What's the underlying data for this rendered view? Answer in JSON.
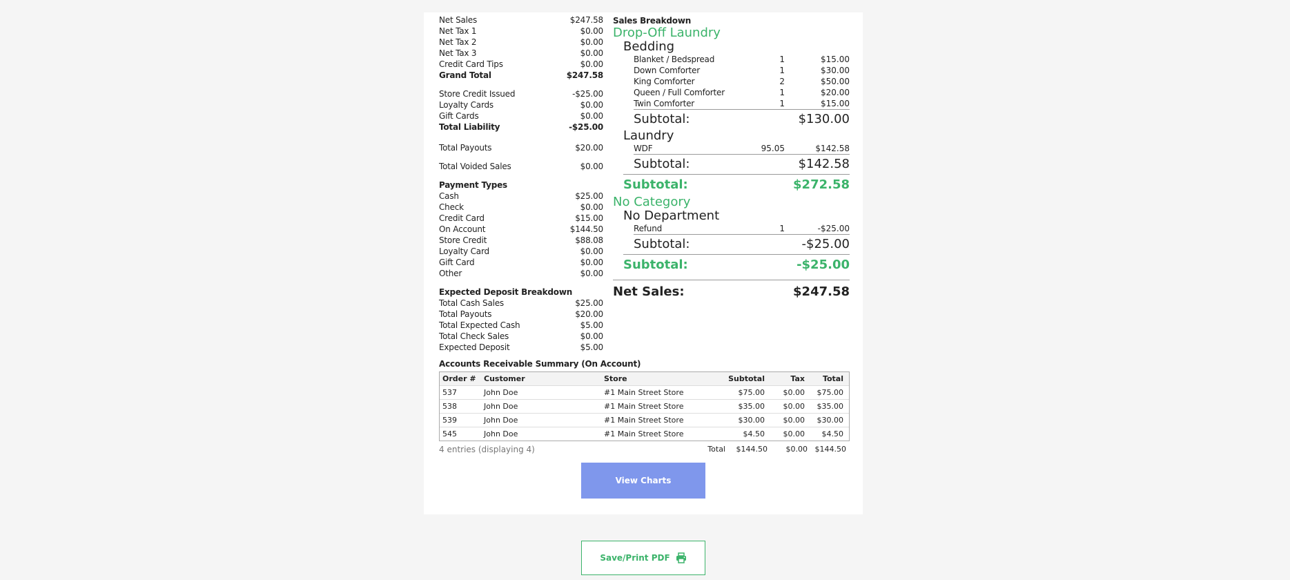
{
  "summary": {
    "totals": [
      {
        "label": "Net Sales",
        "value": "$247.58",
        "bold": false
      },
      {
        "label": "Net Tax 1",
        "value": "$0.00",
        "bold": false
      },
      {
        "label": "Net Tax 2",
        "value": "$0.00",
        "bold": false
      },
      {
        "label": "Net Tax 3",
        "value": "$0.00",
        "bold": false
      },
      {
        "label": "Credit Card Tips",
        "value": "$0.00",
        "bold": false
      },
      {
        "label": "Grand Total",
        "value": "$247.58",
        "bold": true
      }
    ],
    "liability": [
      {
        "label": "Store Credit Issued",
        "value": "-$25.00",
        "bold": false
      },
      {
        "label": "Loyalty Cards",
        "value": "$0.00",
        "bold": false
      },
      {
        "label": "Gift Cards",
        "value": "$0.00",
        "bold": false
      },
      {
        "label": "Total Liability",
        "value": "-$25.00",
        "bold": true
      }
    ],
    "payouts": {
      "label": "Total Payouts",
      "value": "$20.00"
    },
    "voided": {
      "label": "Total Voided Sales",
      "value": "$0.00"
    },
    "payment_types_title": "Payment Types",
    "payment_types": [
      {
        "label": "Cash",
        "value": "$25.00"
      },
      {
        "label": "Check",
        "value": "$0.00"
      },
      {
        "label": "Credit Card",
        "value": "$15.00"
      },
      {
        "label": "On Account",
        "value": "$144.50"
      },
      {
        "label": "Store Credit",
        "value": "$88.08"
      },
      {
        "label": "Loyalty Card",
        "value": "$0.00"
      },
      {
        "label": "Gift Card",
        "value": "$0.00"
      },
      {
        "label": "Other",
        "value": "$0.00"
      }
    ],
    "deposit_title": "Expected Deposit Breakdown",
    "deposit": [
      {
        "label": "Total Cash Sales",
        "value": "$25.00"
      },
      {
        "label": "Total Payouts",
        "value": "$20.00"
      },
      {
        "label": "Total Expected Cash",
        "value": "$5.00"
      },
      {
        "label": "Total Check Sales",
        "value": "$0.00"
      },
      {
        "label": "Expected Deposit",
        "value": "$5.00"
      }
    ]
  },
  "sales_breakdown": {
    "title": "Sales Breakdown",
    "categories": [
      {
        "name": "Drop-Off Laundry",
        "departments": [
          {
            "name": "Bedding",
            "items": [
              {
                "name": "Blanket / Bedspread",
                "qty": "1",
                "amount": "$15.00"
              },
              {
                "name": "Down Comforter",
                "qty": "1",
                "amount": "$30.00"
              },
              {
                "name": "King Comforter",
                "qty": "2",
                "amount": "$50.00"
              },
              {
                "name": "Queen / Full Comforter",
                "qty": "1",
                "amount": "$20.00"
              },
              {
                "name": "Twin Comforter",
                "qty": "1",
                "amount": "$15.00"
              }
            ],
            "subtotal_label": "Subtotal:",
            "subtotal": "$130.00"
          },
          {
            "name": "Laundry",
            "items": [
              {
                "name": "WDF",
                "qty": "95.05",
                "amount": "$142.58"
              }
            ],
            "subtotal_label": "Subtotal:",
            "subtotal": "$142.58"
          }
        ],
        "subtotal_label": "Subtotal:",
        "subtotal": "$272.58"
      },
      {
        "name": "No Category",
        "departments": [
          {
            "name": "No Department",
            "items": [
              {
                "name": "Refund",
                "qty": "1",
                "amount": "-$25.00"
              }
            ],
            "subtotal_label": "Subtotal:",
            "subtotal": "-$25.00"
          }
        ],
        "subtotal_label": "Subtotal:",
        "subtotal": "-$25.00"
      }
    ],
    "net_sales_label": "Net Sales:",
    "net_sales": "$247.58"
  },
  "accounts_receivable": {
    "title": "Accounts Receivable Summary (On Account)",
    "columns": [
      "Order #",
      "Customer",
      "Store",
      "Subtotal",
      "Tax",
      "Total"
    ],
    "rows": [
      [
        "537",
        "John Doe",
        "#1 Main Street Store",
        "$75.00",
        "$0.00",
        "$75.00"
      ],
      [
        "538",
        "John Doe",
        "#1 Main Street Store",
        "$35.00",
        "$0.00",
        "$35.00"
      ],
      [
        "539",
        "John Doe",
        "#1 Main Street Store",
        "$30.00",
        "$0.00",
        "$30.00"
      ],
      [
        "545",
        "John Doe",
        "#1 Main Street Store",
        "$4.50",
        "$0.00",
        "$4.50"
      ]
    ],
    "entries_text": "4 entries (displaying 4)",
    "footer": {
      "label": "Total",
      "subtotal": "$144.50",
      "tax": "$0.00",
      "total": "$144.50"
    }
  },
  "buttons": {
    "view_charts": "View Charts",
    "save_print": "Save/Print PDF"
  },
  "icons": {
    "print": "printer-icon"
  },
  "colors": {
    "accent_green": "#3bb36a",
    "button_blue": "#7f97ec",
    "page_bg": "#f5f5f5"
  }
}
